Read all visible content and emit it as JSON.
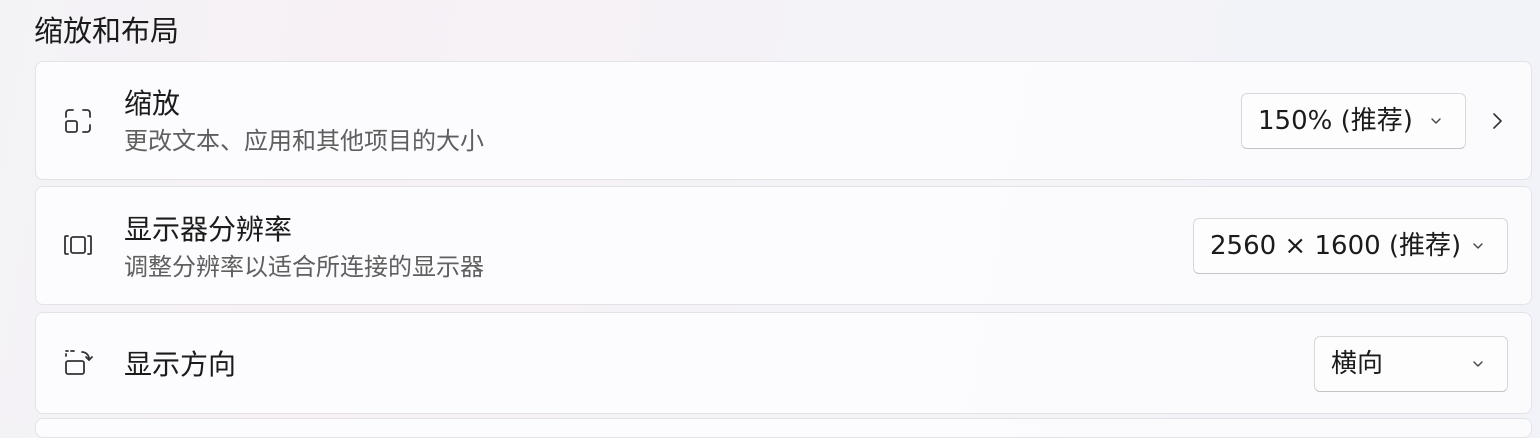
{
  "section": {
    "title": "缩放和布局"
  },
  "scale": {
    "icon": "scale-icon",
    "title": "缩放",
    "subtitle": "更改文本、应用和其他项目的大小",
    "selected": "150% (推荐)",
    "expand_icon": "chevron-right-icon"
  },
  "resolution": {
    "icon": "resolution-icon",
    "title": "显示器分辨率",
    "subtitle": "调整分辨率以适合所连接的显示器",
    "selected": "2560 × 1600 (推荐)"
  },
  "orientation": {
    "icon": "orientation-icon",
    "title": "显示方向",
    "selected": "横向"
  },
  "colors": {
    "card_background": "#fcfcfd",
    "card_border": "#e3e3e6",
    "text_primary": "#1b1b1b",
    "text_secondary": "#5f5f5f"
  }
}
